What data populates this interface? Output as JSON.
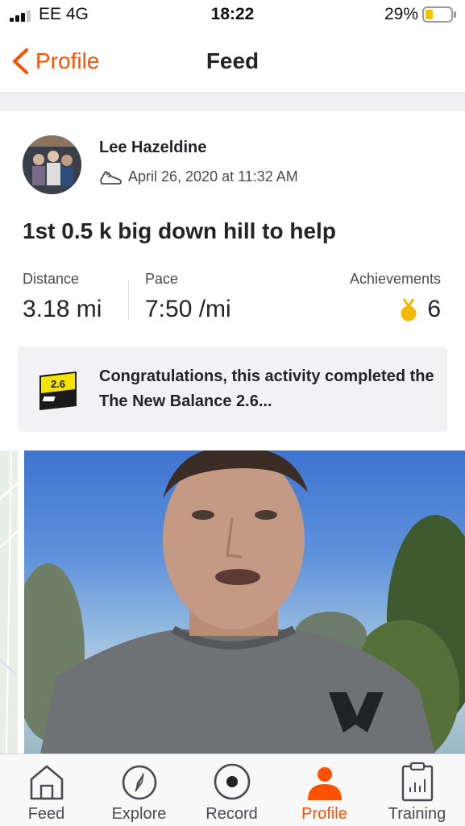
{
  "status_bar": {
    "carrier": "EE  4G",
    "time": "18:22",
    "battery_percent": "29%",
    "battery_level": 0.29,
    "signal_bars": 3
  },
  "nav": {
    "back_label": "Profile",
    "back_icon": "chevron-left-icon",
    "title": "Feed"
  },
  "activity": {
    "athlete_name": "Lee Hazeldine",
    "sport_icon": "shoe-icon",
    "date": "April 26, 2020 at 11:32 AM",
    "title": "1st 0.5 k big down hill to help",
    "stats": {
      "distance_label": "Distance",
      "distance_value": "3.18 mi",
      "pace_label": "Pace",
      "pace_value": "7:50 /mi",
      "achievements_label": "Achievements",
      "achievements_value": "6"
    },
    "achievement_banner": {
      "badge_text": "2.6",
      "text": "Congratulations, this activity completed the The New Balance 2.6..."
    }
  },
  "tab_bar": {
    "tabs": [
      {
        "label": "Feed",
        "icon": "home-icon",
        "active": false
      },
      {
        "label": "Explore",
        "icon": "compass-icon",
        "active": false
      },
      {
        "label": "Record",
        "icon": "record-icon",
        "active": false
      },
      {
        "label": "Profile",
        "icon": "profile-icon",
        "active": true
      },
      {
        "label": "Training",
        "icon": "training-icon",
        "active": false
      }
    ]
  },
  "colors": {
    "accent": "#fc5200",
    "text": "#242428",
    "medal": "#f5b800"
  }
}
